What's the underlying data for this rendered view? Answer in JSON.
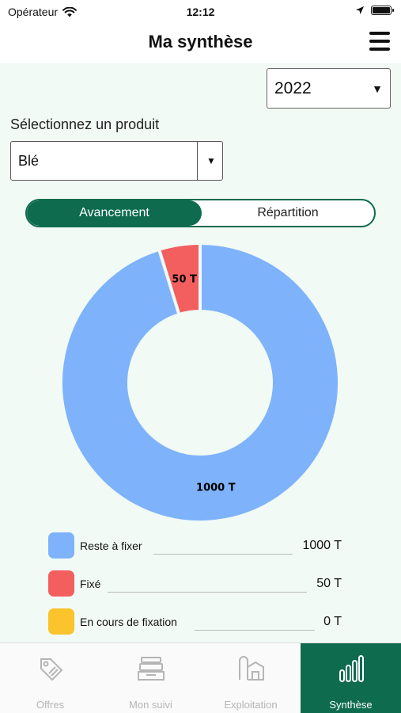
{
  "status_bar": {
    "carrier": "Opérateur",
    "time": "12:12"
  },
  "header": {
    "title": "Ma synthèse"
  },
  "year_select": {
    "value": "2022"
  },
  "product": {
    "label": "Sélectionnez un produit",
    "value": "Blé"
  },
  "toggle": {
    "active": "Avancement",
    "inactive": "Répartition"
  },
  "chart_data": {
    "type": "pie",
    "style": "donut",
    "slices": [
      {
        "name": "Reste à fixer",
        "value": 1000,
        "label": "1000 T",
        "color": "#7eb3fb"
      },
      {
        "name": "Fixé",
        "value": 50,
        "label": "50 T",
        "color": "#f35f5f"
      },
      {
        "name": "En cours de fixation",
        "value": 0,
        "label": "0 T",
        "color": "#fbc32c"
      }
    ]
  },
  "legend": [
    {
      "label": "Reste à fixer",
      "value": "1000 T",
      "color": "#7eb3fb"
    },
    {
      "label": "Fixé",
      "value": "50 T",
      "color": "#f35f5f"
    },
    {
      "label": "En cours de fixation",
      "value": "0 T",
      "color": "#fbc32c"
    }
  ],
  "tabs": [
    {
      "label": "Offres",
      "icon": "tag-icon"
    },
    {
      "label": "Mon suivi",
      "icon": "inbox-icon"
    },
    {
      "label": "Exploitation",
      "icon": "barn-icon"
    },
    {
      "label": "Synthèse",
      "icon": "bar-chart-icon"
    }
  ],
  "colors": {
    "primary": "#0e6b4e",
    "background": "#f1faf5"
  }
}
